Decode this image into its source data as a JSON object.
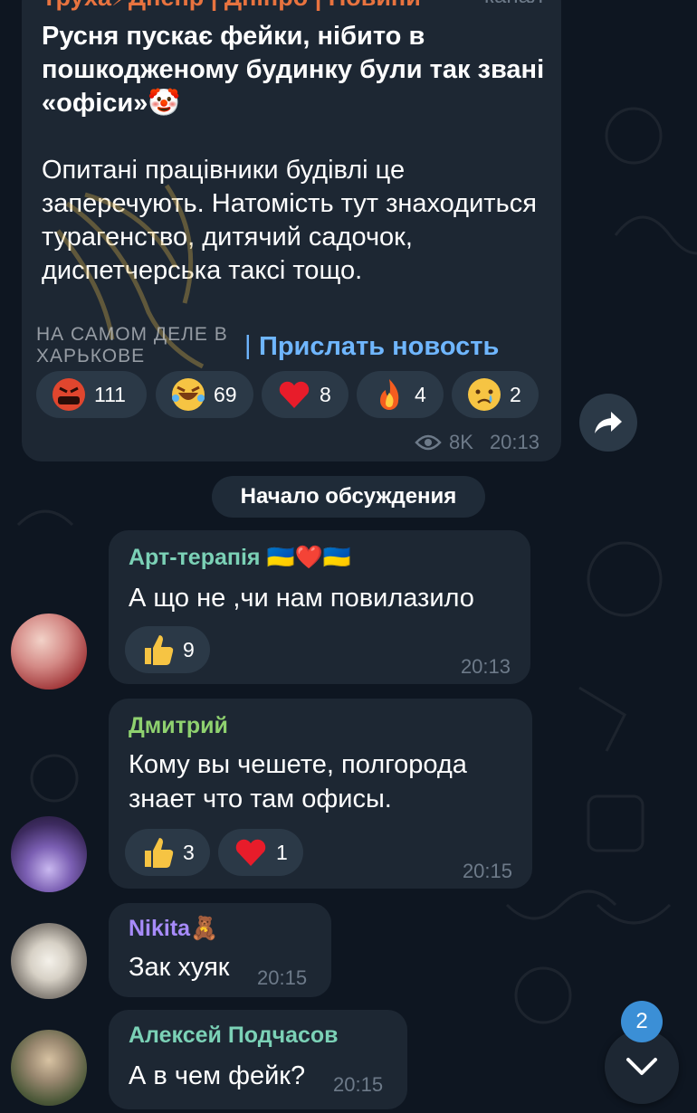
{
  "channel_post": {
    "channel_name": "Труха⚡Днепр | Дніпро | Новини",
    "channel_type": "канал",
    "text_bold": "Русня пускає фейки, нібито в пошкодженому будинку були так звані «офіси»🤡",
    "text_body": "Опитані працівники будівлі це заперечують. Натомість тут знаходиться турагенство, дитячий садочок, диспетчерська таксі тощо.",
    "link_label": "Прислать новость",
    "watermark": "НА САМОМ ДЕЛЕ В\nХАРЬКОВЕ",
    "reactions": [
      {
        "emoji_name": "angry-face-icon",
        "count": "111"
      },
      {
        "emoji_name": "rofl-icon",
        "count": "69"
      },
      {
        "emoji_name": "red-heart-icon",
        "count": "8"
      },
      {
        "emoji_name": "fire-icon",
        "count": "4"
      },
      {
        "emoji_name": "crying-face-icon",
        "count": "2"
      }
    ],
    "views": "8K",
    "time": "20:13"
  },
  "discussion_label": "Начало обсуждения",
  "messages": [
    {
      "author": "Арт-терапія 🇺🇦❤️🇺🇦",
      "author_color": "#7bd1b6",
      "text": "А що не ,чи нам повилазило",
      "time": "20:13",
      "reactions": [
        {
          "emoji_name": "thumbs-up-icon",
          "count": "9"
        }
      ]
    },
    {
      "author": "Дмитрий",
      "author_color": "#8fd16f",
      "text": "Кому вы чешете, полгорода знает что там офисы.",
      "time": "20:15",
      "reactions": [
        {
          "emoji_name": "thumbs-up-icon",
          "count": "3"
        },
        {
          "emoji_name": "red-heart-icon",
          "count": "1"
        }
      ]
    },
    {
      "author": "Nikita🧸",
      "author_color": "#a78bfa",
      "text": "Зак хуяк",
      "time": "20:15"
    },
    {
      "author": "Алексей Подчасов",
      "author_color": "#7bd1b6",
      "text": "А в чем фейк?",
      "time": "20:15"
    }
  ],
  "unread_count": "2",
  "colors": {
    "background": "#0e1621",
    "bubble": "#1d2733",
    "reaction_pill": "#2b3947",
    "link": "#6fb6ff",
    "channel_name": "#e8733f",
    "meta": "#6d7a89",
    "badge": "#3b8fd6"
  }
}
